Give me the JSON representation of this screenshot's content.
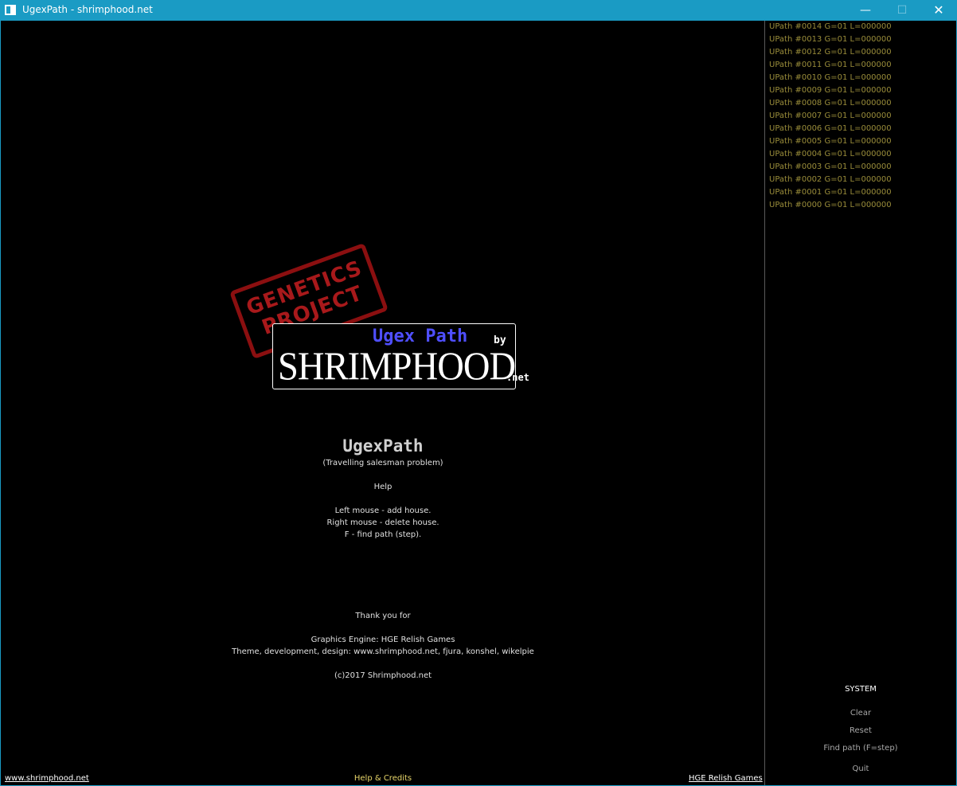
{
  "window": {
    "title": "UgexPath - shrimphood.net",
    "minimize": "—",
    "maximize": "☐",
    "close": "✕"
  },
  "logo": {
    "stamp_line1": "GENETICS",
    "stamp_line2": "PROJECT",
    "product": "Ugex Path",
    "by": "by",
    "brand": "SHRIMPHOOD",
    "net": ".net"
  },
  "info": {
    "app_name": "UgexPath",
    "subtitle": "(Travelling salesman problem)",
    "help_title": "Help",
    "help_lines": [
      "Left mouse - add house.",
      "Right mouse - delete house.",
      "F - find path (step)."
    ],
    "thanks": "Thank you for",
    "credit_engine": "Graphics Engine: HGE Relish Games",
    "credit_theme": "Theme, development, design: www.shrimphood.net, fjura, konshel, wikelpie",
    "copyright": "(c)2017 Shrimphood.net"
  },
  "upaths": [
    "UPath #0014 G=01 L=000000",
    "UPath #0013 G=01 L=000000",
    "UPath #0012 G=01 L=000000",
    "UPath #0011 G=01 L=000000",
    "UPath #0010 G=01 L=000000",
    "UPath #0009 G=01 L=000000",
    "UPath #0008 G=01 L=000000",
    "UPath #0007 G=01 L=000000",
    "UPath #0006 G=01 L=000000",
    "UPath #0005 G=01 L=000000",
    "UPath #0004 G=01 L=000000",
    "UPath #0003 G=01 L=000000",
    "UPath #0002 G=01 L=000000",
    "UPath #0001 G=01 L=000000",
    "UPath #0000 G=01 L=000000"
  ],
  "system": {
    "title": "SYSTEM",
    "clear": "Clear",
    "reset": "Reset",
    "find_path": "Find path (F=step)",
    "quit": "Quit"
  },
  "footer": {
    "left_link": "www.shrimphood.net",
    "middle": "Help & Credits",
    "right_link": "HGE Relish Games"
  },
  "colors": {
    "titlebar": "#1a9bc4",
    "upath_text": "#9a8d3a",
    "stamp": "#a8191b",
    "product": "#4f4fff",
    "footer_middle": "#e8d66a"
  }
}
